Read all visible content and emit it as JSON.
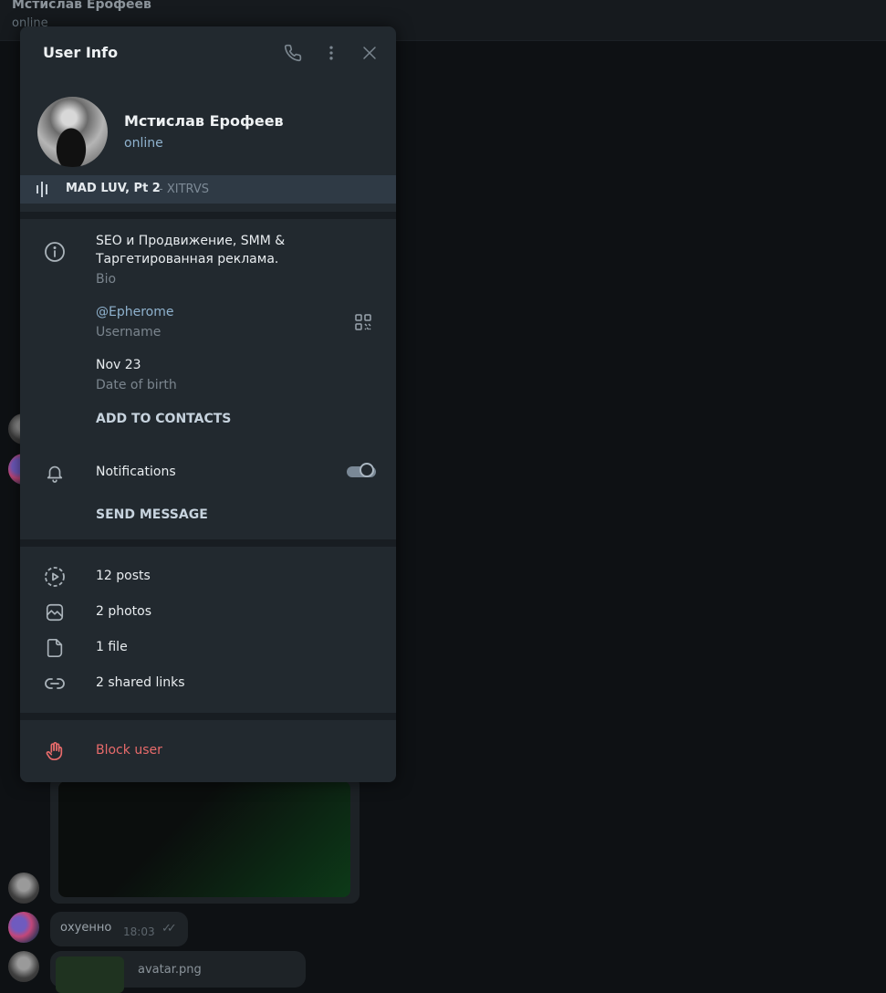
{
  "background": {
    "chat_title": "Мстислав Ерофеев",
    "chat_status": "online",
    "message_text": "охуенно",
    "message_time": "18:03",
    "file_name": "avatar.png"
  },
  "panel": {
    "title": "User Info",
    "header_icons": [
      "phone-icon",
      "more-vertical-icon",
      "close-icon"
    ]
  },
  "profile": {
    "name": "Мстислав Ерофеев",
    "status": "online"
  },
  "music": {
    "title": "MAD LUV, Pt 2",
    "artist": "- XITRVS"
  },
  "info": {
    "bio_line1": "SEO и Продвижение, SMM &",
    "bio_line2": "Таргетированная реклама.",
    "bio_label": "Bio",
    "username": "@Epherome",
    "username_label": "Username",
    "birthday": "Nov 23",
    "birthday_label": "Date of birth",
    "add_contact": "ADD TO CONTACTS",
    "notifications_label": "Notifications",
    "notifications_on": true,
    "send_message": "SEND MESSAGE"
  },
  "media": [
    {
      "icon": "posts-icon",
      "label": "12 posts"
    },
    {
      "icon": "photos-icon",
      "label": "2 photos"
    },
    {
      "icon": "file-icon",
      "label": "1 file"
    },
    {
      "icon": "link-icon",
      "label": "2 shared links"
    }
  ],
  "block": {
    "label": "Block user",
    "color": "#e86b6b"
  },
  "colors": {
    "panel_bg": "#22292f",
    "accent": "#8fb2ce",
    "music_bar": "#2f3a45"
  }
}
